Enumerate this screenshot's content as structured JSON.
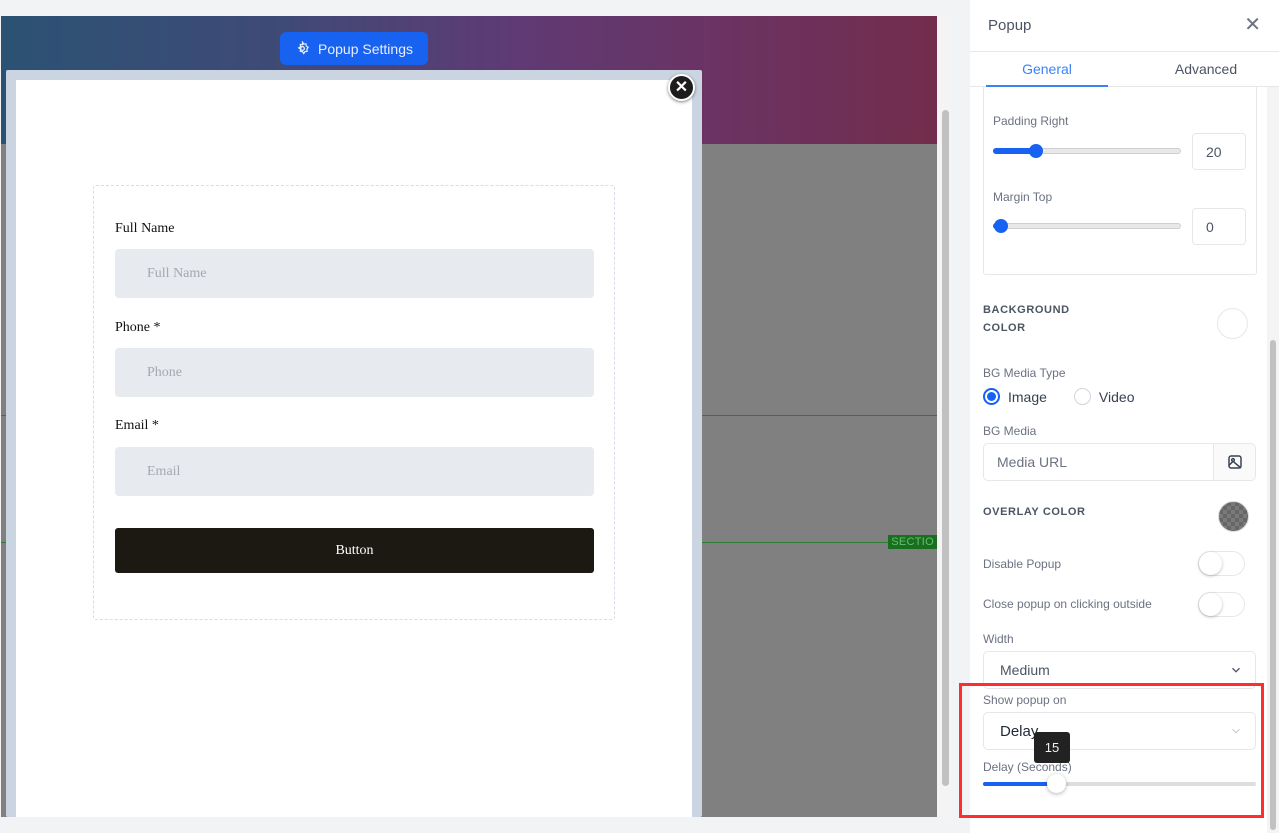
{
  "canvas": {
    "settings_button": "Popup Settings",
    "section_tag": "SECTIO",
    "popup": {
      "close_glyph": "✕",
      "form": {
        "fields": [
          {
            "label": "Full Name",
            "placeholder": "Full Name"
          },
          {
            "label": "Phone *",
            "placeholder": "Phone"
          },
          {
            "label": "Email *",
            "placeholder": "Email"
          }
        ],
        "submit_label": "Button"
      }
    }
  },
  "panel": {
    "title": "Popup",
    "close_glyph": "✕",
    "tabs": [
      {
        "label": "General",
        "active": true
      },
      {
        "label": "Advanced",
        "active": false
      }
    ],
    "padding_right": {
      "label": "Padding Right",
      "value": "20",
      "fraction": 0.2
    },
    "margin_top": {
      "label": "Margin Top",
      "value": "0",
      "fraction": 0
    },
    "background_color_label": "BACKGROUND COLOR",
    "background_color_line1": "BACKGROUND",
    "background_color_line2": "COLOR",
    "bg_media_type": {
      "label": "BG Media Type",
      "options": [
        "Image",
        "Video"
      ],
      "selected": "Image"
    },
    "bg_media": {
      "label": "BG Media",
      "placeholder": "Media URL",
      "icon": "image-icon"
    },
    "overlay_color_label": "OVERLAY COLOR",
    "disable_popup": {
      "label": "Disable Popup",
      "on": false
    },
    "close_outside": {
      "label": "Close popup on clicking outside",
      "on": false
    },
    "width": {
      "label": "Width",
      "value": "Medium"
    },
    "show_popup_on": {
      "label": "Show popup on",
      "value": "Delay"
    },
    "delay": {
      "label": "Delay (Seconds)",
      "value": "15",
      "fraction": 0.25
    }
  },
  "colors": {
    "accent": "#1762f0",
    "tab_active": "#3b82f6",
    "highlight": "#ff2d2d",
    "button_dark": "#1c1812"
  }
}
